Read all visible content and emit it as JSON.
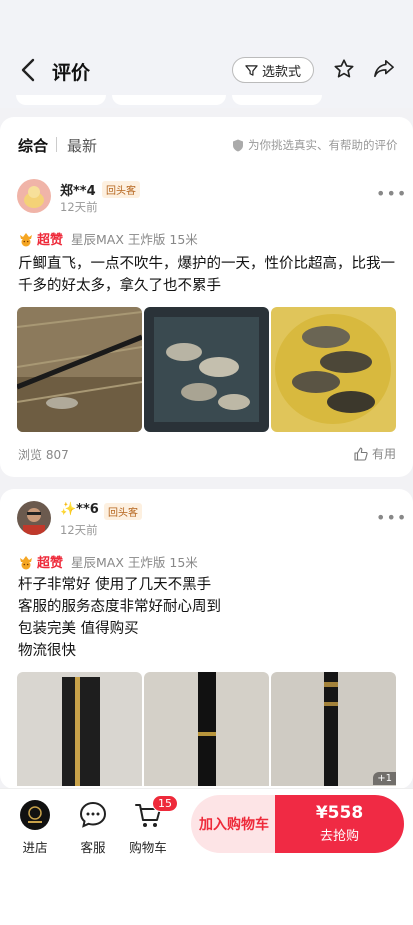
{
  "header": {
    "title": "评价",
    "filter_label": "选款式"
  },
  "tabs": {
    "active": "综合",
    "other": "最新",
    "note": "为你挑选真实、有帮助的评价"
  },
  "reviews": [
    {
      "user": "郑**4",
      "badge": "回头客",
      "time": "12天前",
      "praise": "超赞",
      "product": "星辰MAX 王炸版 15米",
      "content": "斤鲫直飞，一点不吹牛，爆护的一天，性价比超高，比我一千多的好太多，拿久了也不累手",
      "views": "浏览 807",
      "useful": "有用"
    },
    {
      "user": "✨**6",
      "badge": "回头客",
      "time": "12天前",
      "praise": "超赞",
      "product": "星辰MAX 王炸版 15米",
      "lines": [
        "杆子非常好 使用了几天不黑手",
        "客服的服务态度非常好耐心周到",
        "包装完美 值得购买",
        "物流很快"
      ],
      "photo_more": "+1"
    }
  ],
  "bottom_bar": {
    "store": "进店",
    "service": "客服",
    "cart": "购物车",
    "cart_count": "15",
    "add_to_cart": "加入购物车",
    "price": "¥558",
    "buy": "去抢购"
  },
  "colors": {
    "accent": "#ee2a3a",
    "buy_bg": "#f02a44",
    "addcart_bg": "#fde4e6"
  }
}
